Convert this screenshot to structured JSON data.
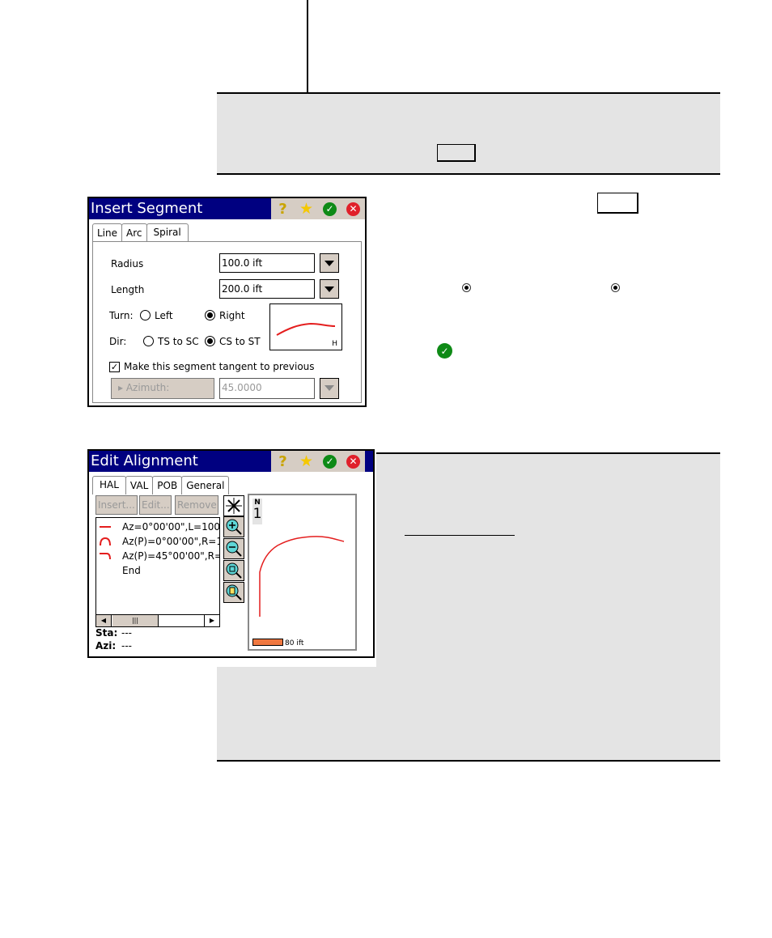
{
  "note_top": {
    "key_label": ""
  },
  "insert_segment": {
    "title": "Insert Segment",
    "title_icons": [
      "help-icon",
      "favorites-star-icon",
      "ok-check-icon",
      "cancel-x-icon"
    ],
    "tabs": [
      {
        "label": "Line",
        "active": false
      },
      {
        "label": "Arc",
        "active": false
      },
      {
        "label": "Spiral",
        "active": true
      }
    ],
    "radius": {
      "label": "Radius",
      "value": "100.0 ift"
    },
    "length": {
      "label": "Length",
      "value": "200.0 ift"
    },
    "turn": {
      "label": "Turn:",
      "options": [
        "Left",
        "Right"
      ],
      "selected": "Right"
    },
    "dir": {
      "label": "Dir:",
      "options": [
        "TS to SC",
        "CS to ST"
      ],
      "selected": "CS to ST"
    },
    "preview_label": "H",
    "tangent_checkbox": {
      "label": "Make this segment tangent to previous",
      "checked": true
    },
    "azimuth": {
      "button_label": "▸ Azimuth:",
      "value": "45.0000",
      "disabled": true
    }
  },
  "right_text": {
    "key_label": ""
  },
  "edit_alignment": {
    "title": "Edit Alignment",
    "tabs": [
      {
        "label": "HAL",
        "active": true
      },
      {
        "label": "VAL",
        "active": false
      },
      {
        "label": "POB",
        "active": false
      },
      {
        "label": "General",
        "active": false
      }
    ],
    "buttons": {
      "insert": "Insert...",
      "edit": "Edit...",
      "remove": "Remove"
    },
    "segments": [
      {
        "type": "line",
        "text": "Az=0°00'00\",L=100."
      },
      {
        "type": "arc",
        "text": "Az(P)=0°00'00\",R=1"
      },
      {
        "type": "spiral",
        "text": "Az(P)=45°00'00\",R="
      },
      {
        "type": "end",
        "text": "End"
      }
    ],
    "sta": {
      "label": "Sta:",
      "value": "---"
    },
    "azi": {
      "label": "Azi:",
      "value": "---"
    },
    "map_tools": [
      "zoom-extents-icon",
      "zoom-in-icon",
      "zoom-out-icon",
      "zoom-window-icon",
      "zoom-page-icon"
    ],
    "north_label": "N",
    "north_value": "1",
    "scale_label": "80 ift",
    "colors": {
      "alignment": "#e41e1e",
      "scale_bar": "#f07840",
      "titlebar": "#000080"
    }
  }
}
